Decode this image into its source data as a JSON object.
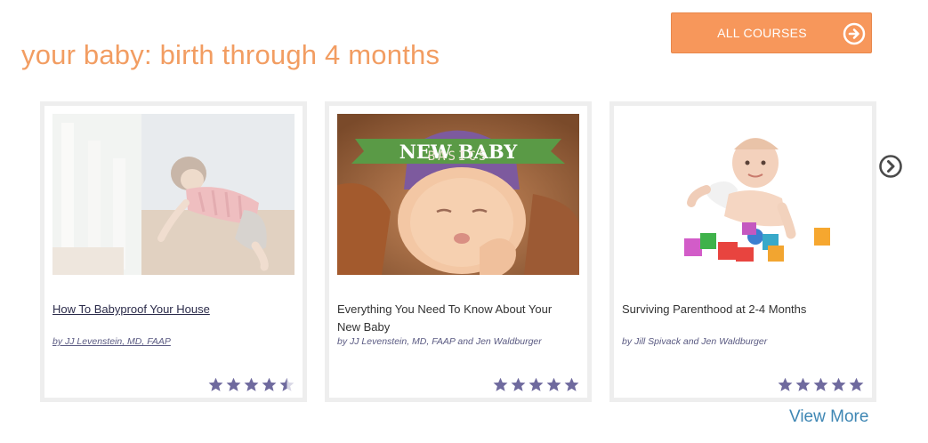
{
  "section": {
    "title": "your baby: birth through 4 months"
  },
  "header": {
    "all_courses_label": "ALL COURSES"
  },
  "colors": {
    "accent": "#f7975b",
    "star": "#6f6a9e",
    "link": "#3f87b4"
  },
  "courses": [
    {
      "title": "How To Babyproof Your House",
      "author": "by JJ Levenstein, MD, FAAP",
      "rating": 4.5,
      "rating_max": 5
    },
    {
      "title": "Everything You Need To Know About Your New Baby",
      "author": "by JJ Levenstein, MD, FAAP and Jen Waldburger",
      "rating": 5,
      "rating_max": 5,
      "banner_title": "NEW BABY",
      "banner_subtitle": "BASICS"
    },
    {
      "title": "Surviving Parenthood at 2-4 Months",
      "author": "by Jill Spivack and Jen Waldburger",
      "rating": 5,
      "rating_max": 5
    }
  ],
  "footer": {
    "view_more_label": "View More"
  },
  "icons": {
    "all_courses": "arrow-circle-right-icon",
    "next": "chevron-circle-right-icon",
    "star": "star-icon"
  }
}
